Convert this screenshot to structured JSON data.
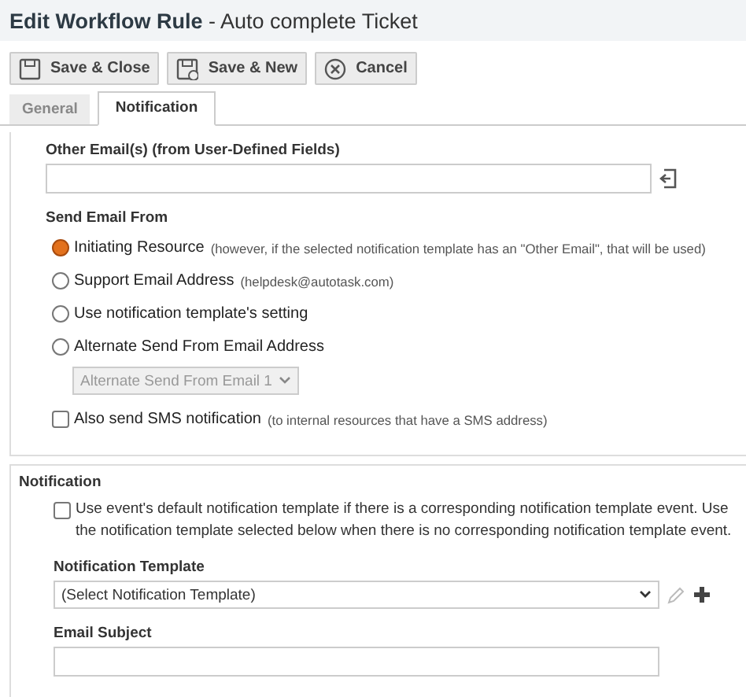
{
  "window": {
    "title": "**Edit Workflow Rule** - Auto complete Ticket"
  },
  "toolbar": [
    {
      "label": "Save & Close",
      "kind": "save"
    },
    {
      "label": "Save & New",
      "kind": "save-new"
    },
    {
      "label": "Cancel",
      "kind": "cancel"
    }
  ],
  "tabs": [
    {
      "label": "General",
      "selected": false
    },
    {
      "label": "Notification",
      "selected": true
    }
  ],
  "email_panel": {
    "other_emails": {
      "label": "Other Email(s) (from User-Defined Fields)"
    },
    "send_from": {
      "label": "Send Email From",
      "options": [
        {
          "label": "Initiating Resource",
          "note": "(however, if the selected notification template has an \"Other Email\", that will be used)",
          "selected": true
        },
        {
          "label": "Support Email Address",
          "note": "(helpdesk@autotask.com)",
          "selected": false
        },
        {
          "label": "Use notification template's setting",
          "selected": false
        },
        {
          "label": "Alternate Send From Email Address",
          "selected": false
        }
      ],
      "alternate": {
        "value": "Alternate Send From Email 1",
        "disabled": true
      }
    },
    "sms": {
      "label": "Also send SMS notification",
      "note": "(to internal resources that have a SMS address)",
      "checked": false
    }
  },
  "notification_panel": {
    "title": "Notification",
    "default_template": {
      "text": "Use event's default notification template if there is a corresponding notification template event. Use the notification template selected below when there is no corresponding notification template event.",
      "checked": false
    },
    "template": {
      "label": "Notification Template",
      "value": "(Select Notification Template)"
    },
    "email_subject": {
      "label": "Email Subject"
    }
  }
}
